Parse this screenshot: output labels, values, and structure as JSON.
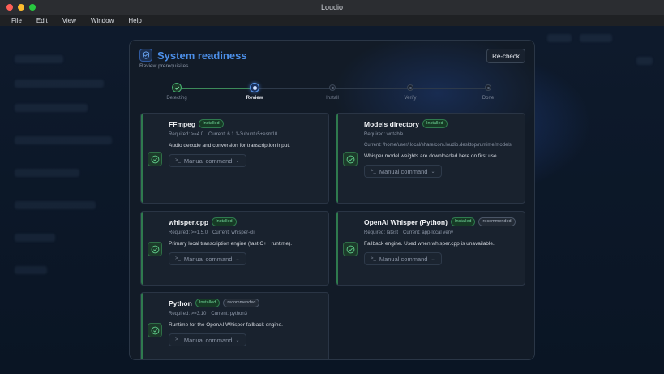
{
  "window": {
    "title": "Loudio"
  },
  "menubar": {
    "items": [
      "File",
      "Edit",
      "View",
      "Window",
      "Help"
    ]
  },
  "dialog": {
    "title": "System readiness",
    "subtitle": "Review prerequisites",
    "recheck_label": "Re-check",
    "steps": [
      {
        "label": "Detecting",
        "state": "complete"
      },
      {
        "label": "Review",
        "state": "current"
      },
      {
        "label": "Install",
        "state": "pending"
      },
      {
        "label": "Verify",
        "state": "pending"
      },
      {
        "label": "Done",
        "state": "pending"
      }
    ],
    "cards": [
      {
        "name": "FFmpeg",
        "badges": [
          "Installed"
        ],
        "required": "Required: >=4.0",
        "current": "Current: 6.1.1-3ubuntu5+esm10",
        "description": "Audio decode and conversion for transcription input.",
        "manual_label": "Manual command"
      },
      {
        "name": "Models directory",
        "badges": [
          "Installed"
        ],
        "required": "Required: writable",
        "current": "Current: /home/user/.local/share/com.loudio.desktop/runtime/models",
        "description": "Whisper model weights are downloaded here on first use.",
        "manual_label": "Manual command"
      },
      {
        "name": "whisper.cpp",
        "badges": [
          "Installed"
        ],
        "required": "Required: >=1.5.0",
        "current": "Current: whisper-cli",
        "description": "Primary local transcription engine (fast C++ runtime).",
        "manual_label": "Manual command"
      },
      {
        "name": "OpenAI Whisper (Python)",
        "badges": [
          "Installed",
          "recommended"
        ],
        "required": "Required: latest",
        "current": "Current: app-local venv",
        "description": "Fallback engine. Used when whisper.cpp is unavailable.",
        "manual_label": "Manual command"
      },
      {
        "name": "Python",
        "badges": [
          "Installed",
          "recommended"
        ],
        "required": "Required: >=3.10",
        "current": "Current: python3",
        "description": "Runtime for the OpenAI Whisper fallback engine.",
        "manual_label": "Manual command"
      }
    ]
  },
  "colors": {
    "accent": "#4c8fe8",
    "success": "#46b06e",
    "panel": "#121b27",
    "card": "#19222e"
  }
}
